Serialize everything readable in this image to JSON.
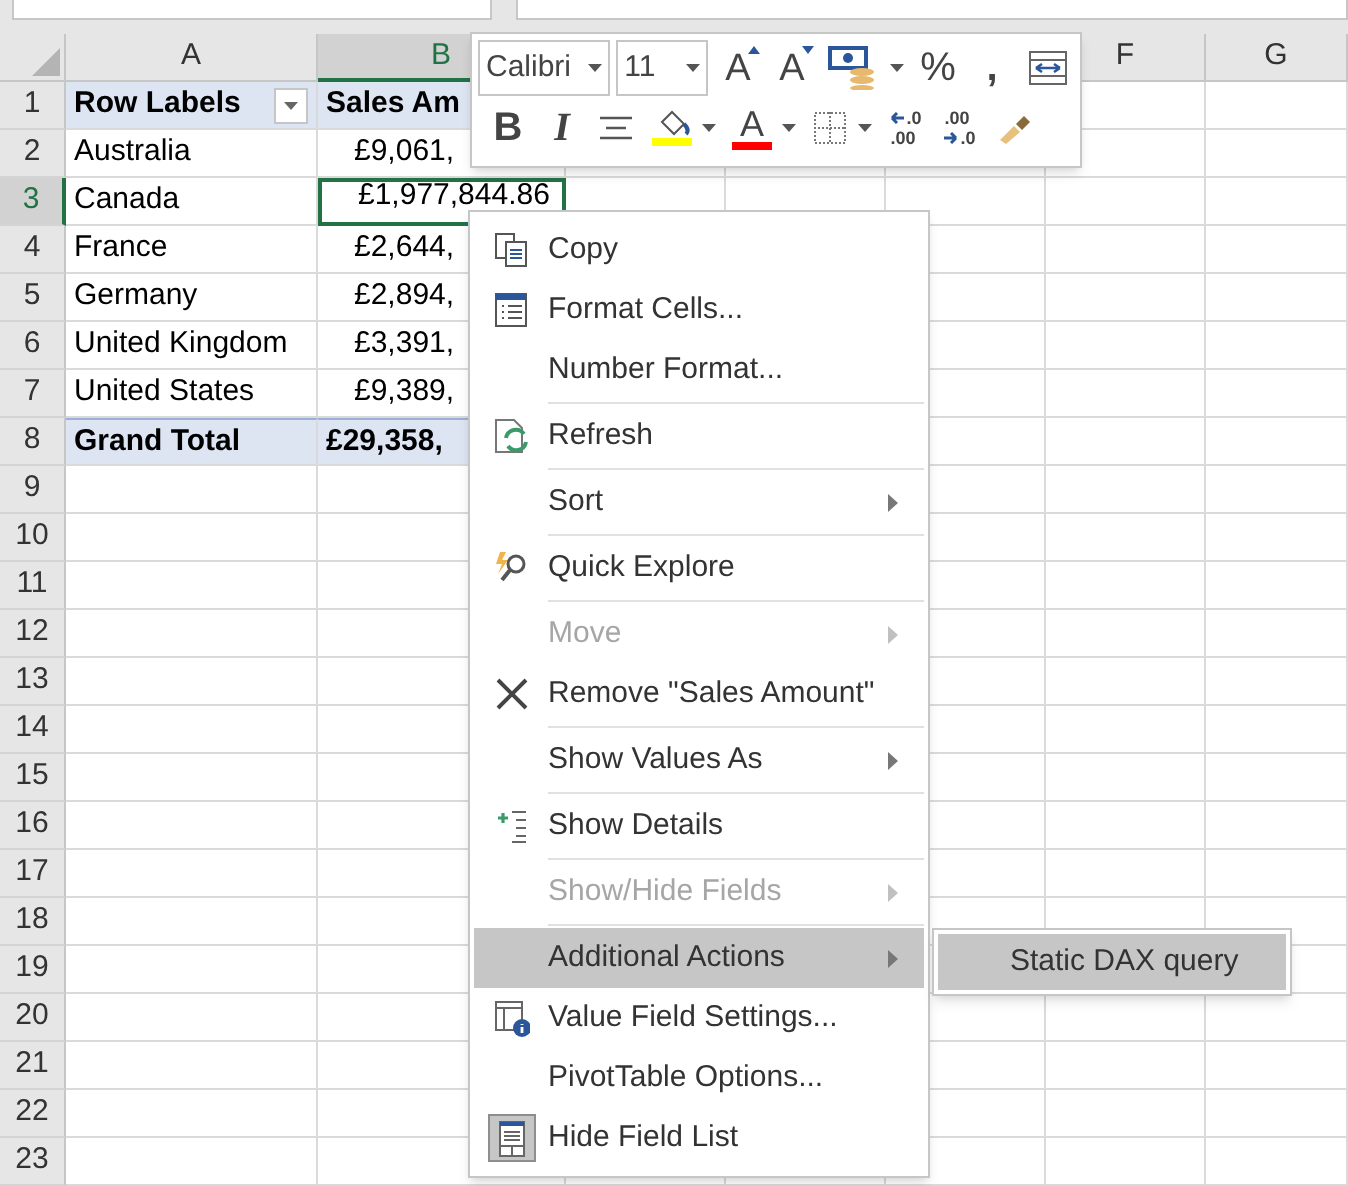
{
  "columns": [
    {
      "label": "A",
      "selected": false
    },
    {
      "label": "B",
      "selected": true
    },
    null,
    null,
    null,
    {
      "label": "F",
      "selected": false
    },
    {
      "label": "G",
      "selected": false
    }
  ],
  "rows": [
    {
      "number": "1",
      "selected": false,
      "kind": "header",
      "cells": [
        "Row Labels",
        "Sales Am"
      ]
    },
    {
      "number": "2",
      "selected": false,
      "kind": "data",
      "cells": [
        "Australia",
        "£9,061,"
      ]
    },
    {
      "number": "3",
      "selected": true,
      "kind": "data",
      "cells": [
        "Canada",
        "£1,977,844.86"
      ]
    },
    {
      "number": "4",
      "selected": false,
      "kind": "data",
      "cells": [
        "France",
        "£2,644,"
      ]
    },
    {
      "number": "5",
      "selected": false,
      "kind": "data",
      "cells": [
        "Germany",
        "£2,894,"
      ]
    },
    {
      "number": "6",
      "selected": false,
      "kind": "data",
      "cells": [
        "United Kingdom",
        "£3,391,"
      ]
    },
    {
      "number": "7",
      "selected": false,
      "kind": "data",
      "cells": [
        "United States",
        "£9,389,"
      ]
    },
    {
      "number": "8",
      "selected": false,
      "kind": "total",
      "cells": [
        "Grand Total",
        "£29,358,"
      ]
    },
    {
      "number": "9",
      "selected": false,
      "kind": "empty"
    },
    {
      "number": "10",
      "selected": false,
      "kind": "empty"
    },
    {
      "number": "11",
      "selected": false,
      "kind": "empty"
    },
    {
      "number": "12",
      "selected": false,
      "kind": "empty"
    },
    {
      "number": "13",
      "selected": false,
      "kind": "empty"
    },
    {
      "number": "14",
      "selected": false,
      "kind": "empty"
    },
    {
      "number": "15",
      "selected": false,
      "kind": "empty"
    },
    {
      "number": "16",
      "selected": false,
      "kind": "empty"
    },
    {
      "number": "17",
      "selected": false,
      "kind": "empty"
    },
    {
      "number": "18",
      "selected": false,
      "kind": "empty"
    },
    {
      "number": "19",
      "selected": false,
      "kind": "empty"
    },
    {
      "number": "20",
      "selected": false,
      "kind": "empty"
    },
    {
      "number": "21",
      "selected": false,
      "kind": "empty"
    },
    {
      "number": "22",
      "selected": false,
      "kind": "empty"
    },
    {
      "number": "23",
      "selected": false,
      "kind": "empty"
    }
  ],
  "mini_toolbar": {
    "font_name": "Calibri",
    "font_size": "11",
    "row_1": [
      {
        "kind": "grow_font",
        "glyph": "A",
        "dropdown": false
      },
      {
        "kind": "shrink_font",
        "glyph": "A",
        "dropdown": false
      },
      {
        "kind": "accounting",
        "dropdown": true
      },
      {
        "kind": "text",
        "glyph": "%",
        "dropdown": false
      },
      {
        "kind": "text",
        "glyph": ",",
        "dropdown": false
      },
      {
        "kind": "wrap",
        "dropdown": false
      }
    ],
    "row_2": [
      {
        "kind": "text_bold",
        "glyph": "B",
        "dropdown": false
      },
      {
        "kind": "text_italic",
        "glyph": "I",
        "dropdown": false
      },
      {
        "kind": "center",
        "dropdown": false
      },
      {
        "kind": "fill_color",
        "color": "#ffff00",
        "dropdown": true
      },
      {
        "kind": "font_color",
        "glyph": "A",
        "color": "#ff0000",
        "dropdown": true
      },
      {
        "kind": "borders",
        "dropdown": true
      },
      {
        "kind": "increase_decimal",
        "glyph_top": ".0",
        "glyph_bottom": ".00",
        "dropdown": false
      },
      {
        "kind": "decrease_decimal",
        "glyph_top": ".00",
        "glyph_bottom": ".0",
        "dropdown": false
      },
      {
        "kind": "format_painter",
        "dropdown": false
      }
    ]
  },
  "context_menu": {
    "groups": [
      [
        {
          "label": "Copy",
          "kind": "copy",
          "disabled": false,
          "submenu": false,
          "selected": false
        },
        {
          "label": "Format Cells...",
          "kind": "format_cells",
          "disabled": false,
          "submenu": false,
          "selected": false
        },
        {
          "label": "Number Format...",
          "disabled": false,
          "submenu": false,
          "selected": false
        }
      ],
      [
        {
          "label": "Refresh",
          "kind": "refresh",
          "disabled": false,
          "submenu": false,
          "selected": false
        }
      ],
      [
        {
          "label": "Sort",
          "disabled": false,
          "submenu": true,
          "selected": false
        }
      ],
      [
        {
          "label": "Quick Explore",
          "kind": "quick_explore",
          "disabled": false,
          "submenu": false,
          "selected": false
        }
      ],
      [
        {
          "label": "Move",
          "disabled": true,
          "submenu": true,
          "selected": false
        },
        {
          "label": "Remove \"Sales Amount\"",
          "kind": "remove",
          "disabled": false,
          "submenu": false,
          "selected": false
        }
      ],
      [
        {
          "label": "Show Values As",
          "disabled": false,
          "submenu": true,
          "selected": false
        }
      ],
      [
        {
          "label": "Show Details",
          "kind": "show_details",
          "disabled": false,
          "submenu": false,
          "selected": false
        }
      ],
      [
        {
          "label": "Show/Hide Fields",
          "disabled": true,
          "submenu": true,
          "selected": false
        }
      ],
      [
        {
          "label": "Additional Actions",
          "disabled": false,
          "submenu": true,
          "selected": true
        },
        {
          "label": "Value Field Settings...",
          "kind": "value_field_settings",
          "disabled": false,
          "submenu": false,
          "selected": false
        },
        {
          "label": "PivotTable Options...",
          "disabled": false,
          "submenu": false,
          "selected": false
        },
        {
          "label": "Hide Field List",
          "kind": "field_list",
          "checked": true,
          "disabled": false,
          "submenu": false,
          "selected": false
        }
      ]
    ],
    "submenu": {
      "items": [
        {
          "label": "Static DAX query",
          "selected": true
        }
      ]
    }
  }
}
